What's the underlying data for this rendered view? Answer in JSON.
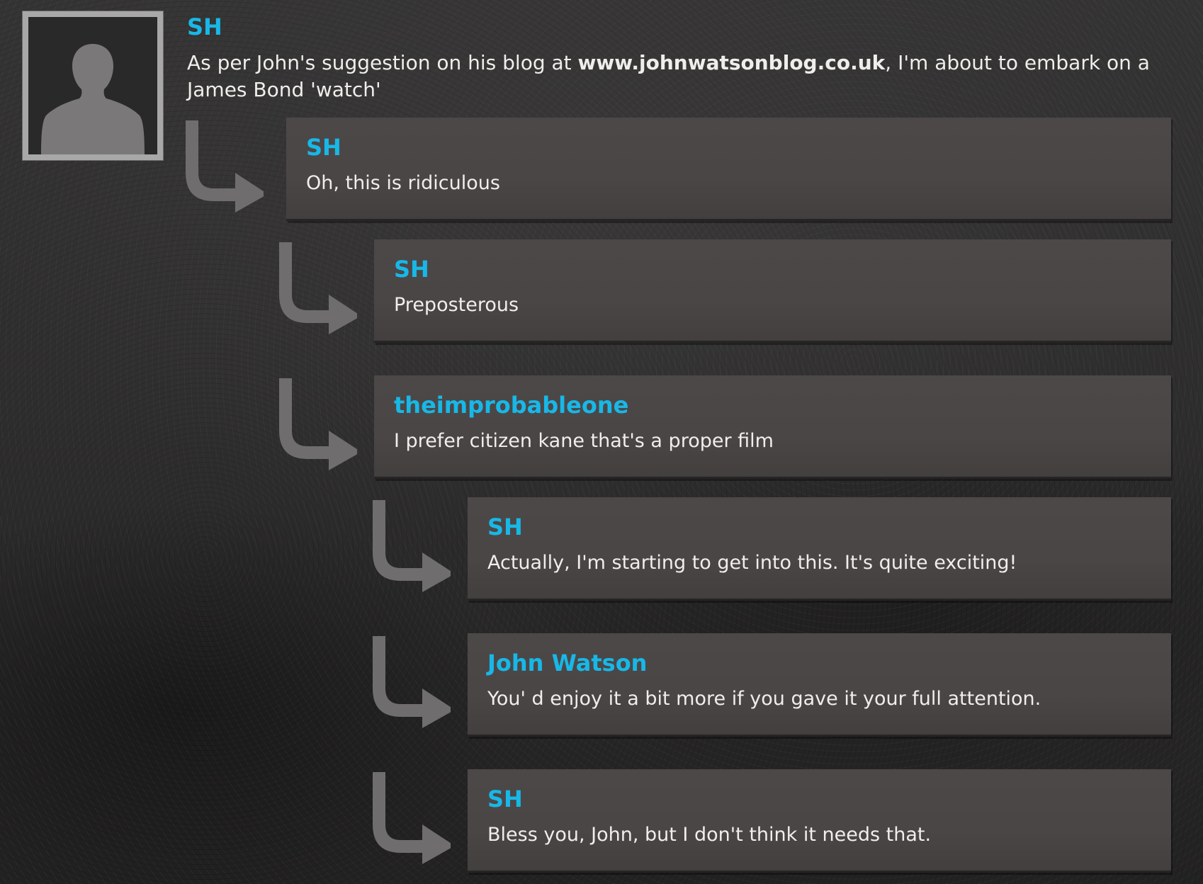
{
  "post": {
    "author": "SH",
    "text_before": "As per John's suggestion on his blog at ",
    "link": "www.johnwatsonblog.co.uk",
    "text_after": ", I'm about to embark on a James Bond 'watch'"
  },
  "replies": [
    {
      "author": "SH",
      "text": "Oh, this is ridiculous",
      "level": 1
    },
    {
      "author": "SH",
      "text": "Preposterous",
      "level": 2
    },
    {
      "author": "theimprobableone",
      "text": "I prefer citizen kane that's a proper film",
      "level": 2
    },
    {
      "author": "SH",
      "text": "Actually, I'm starting to get into this. It's quite exciting!",
      "level": 3
    },
    {
      "author": "John Watson",
      "text": "You' d enjoy it a bit more if you gave it your full attention.",
      "level": 3
    },
    {
      "author": "SH",
      "text": "Bless you, John, but I don't think it needs that.",
      "level": 3
    }
  ],
  "icons": {
    "avatar": "person-silhouette-icon",
    "reply_arrow": "reply-arrow-icon"
  },
  "colors": {
    "author": "#17b8e8",
    "text": "#f0eeea",
    "box": "#4a4646",
    "arrow": "#6f6d6d"
  }
}
